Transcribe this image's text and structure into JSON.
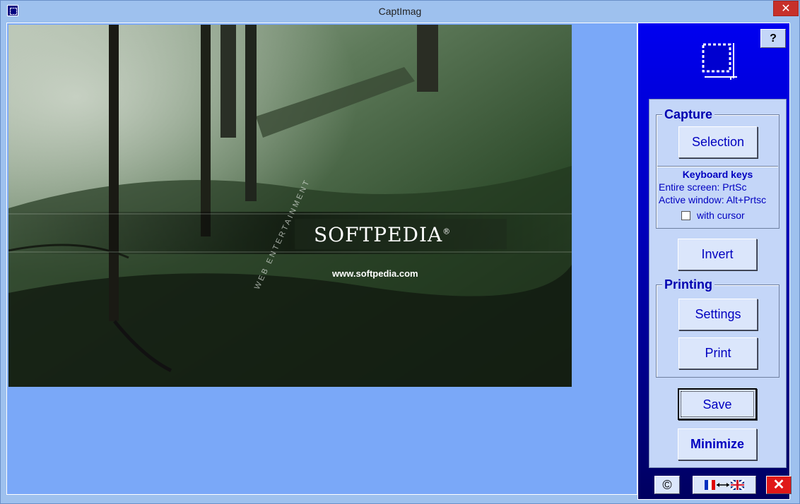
{
  "window": {
    "title": "CaptImag",
    "close_glyph": "✕"
  },
  "photo": {
    "brand": "SOFTPEDIA",
    "registered": "®",
    "url": "www.softpedia.com",
    "arc_text": "WEB ENTERTAINMENT"
  },
  "panel": {
    "help_label": "?",
    "capture": {
      "title": "Capture",
      "selection_label": "Selection",
      "keyboard_title": "Keyboard keys",
      "entire_screen": "Entire screen: PrtSc",
      "active_window": "Active window: Alt+Prtsc",
      "with_cursor_label": "with cursor",
      "with_cursor_checked": false
    },
    "invert_label": "Invert",
    "printing": {
      "title": "Printing",
      "settings_label": "Settings",
      "print_label": "Print"
    },
    "save_label": "Save",
    "minimize_label": "Minimize",
    "copyright_label": "©",
    "exit_label": "✕"
  },
  "colors": {
    "panel_blue": "#0000f0",
    "canvas_blue": "#7aa8f8",
    "button_text": "#0000c0",
    "exit_red": "#e01818"
  }
}
